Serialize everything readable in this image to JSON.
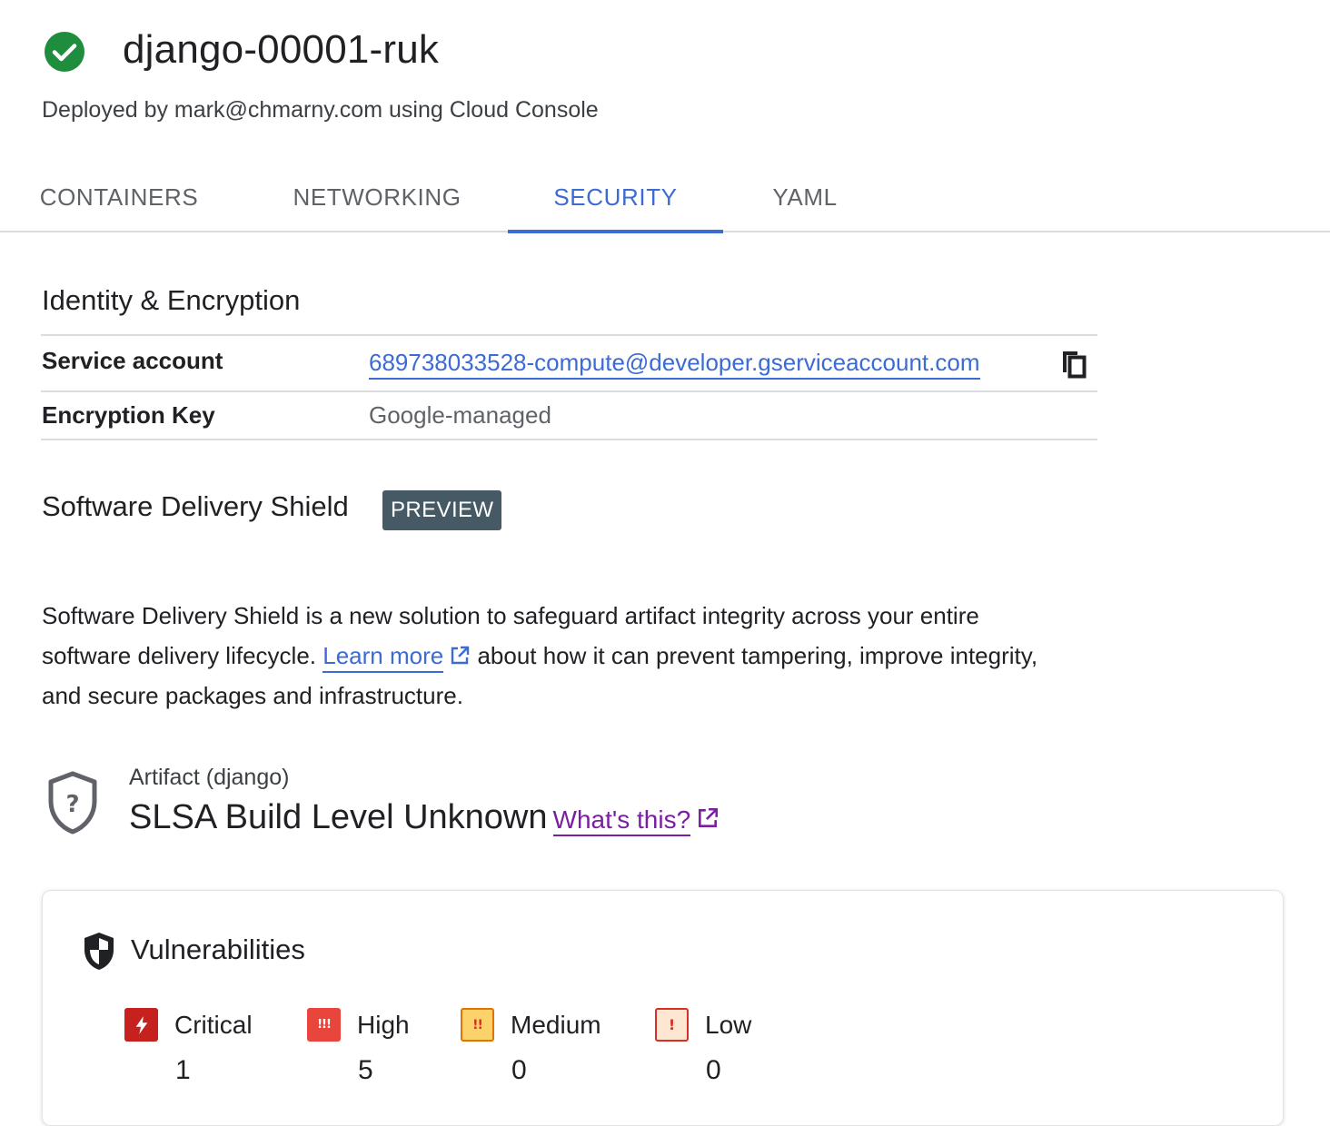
{
  "header": {
    "status_icon": "check-circle-icon",
    "title": "django-00001-ruk",
    "subtitle": "Deployed by mark@chmarny.com using Cloud Console"
  },
  "tabs": [
    {
      "label": "CONTAINERS",
      "active": false
    },
    {
      "label": "NETWORKING",
      "active": false
    },
    {
      "label": "SECURITY",
      "active": true
    },
    {
      "label": "YAML",
      "active": false
    }
  ],
  "identity": {
    "heading": "Identity & Encryption",
    "rows": [
      {
        "key": "Service account",
        "value": "689738033528-compute@developer.gserviceaccount.com",
        "copy_icon": "copy-icon"
      },
      {
        "key": "Encryption Key",
        "value": "Google-managed"
      }
    ]
  },
  "sds": {
    "heading": "Software Delivery Shield",
    "badge": "PREVIEW",
    "para_before": "Software Delivery Shield is a new solution to safeguard artifact integrity across your entire software delivery lifecycle.",
    "learn_more": "Learn more",
    "para_after": "about how it can prevent tampering, improve integrity, and secure packages and infrastructure."
  },
  "artifact": {
    "icon": "shield-question-icon",
    "label": "Artifact (django)",
    "slsa": "SLSA Build Level Unknown",
    "whats_this": "What's this?"
  },
  "vulnerabilities": {
    "icon": "shield-icon",
    "title": "Vulnerabilities",
    "severities": [
      {
        "label": "Critical",
        "count": "1",
        "color": "#c5221f"
      },
      {
        "label": "High",
        "count": "5",
        "color": "#e8453c"
      },
      {
        "label": "Medium",
        "count": "0",
        "color": "#f29900"
      },
      {
        "label": "Low",
        "count": "0",
        "color": "#d93025"
      }
    ]
  }
}
